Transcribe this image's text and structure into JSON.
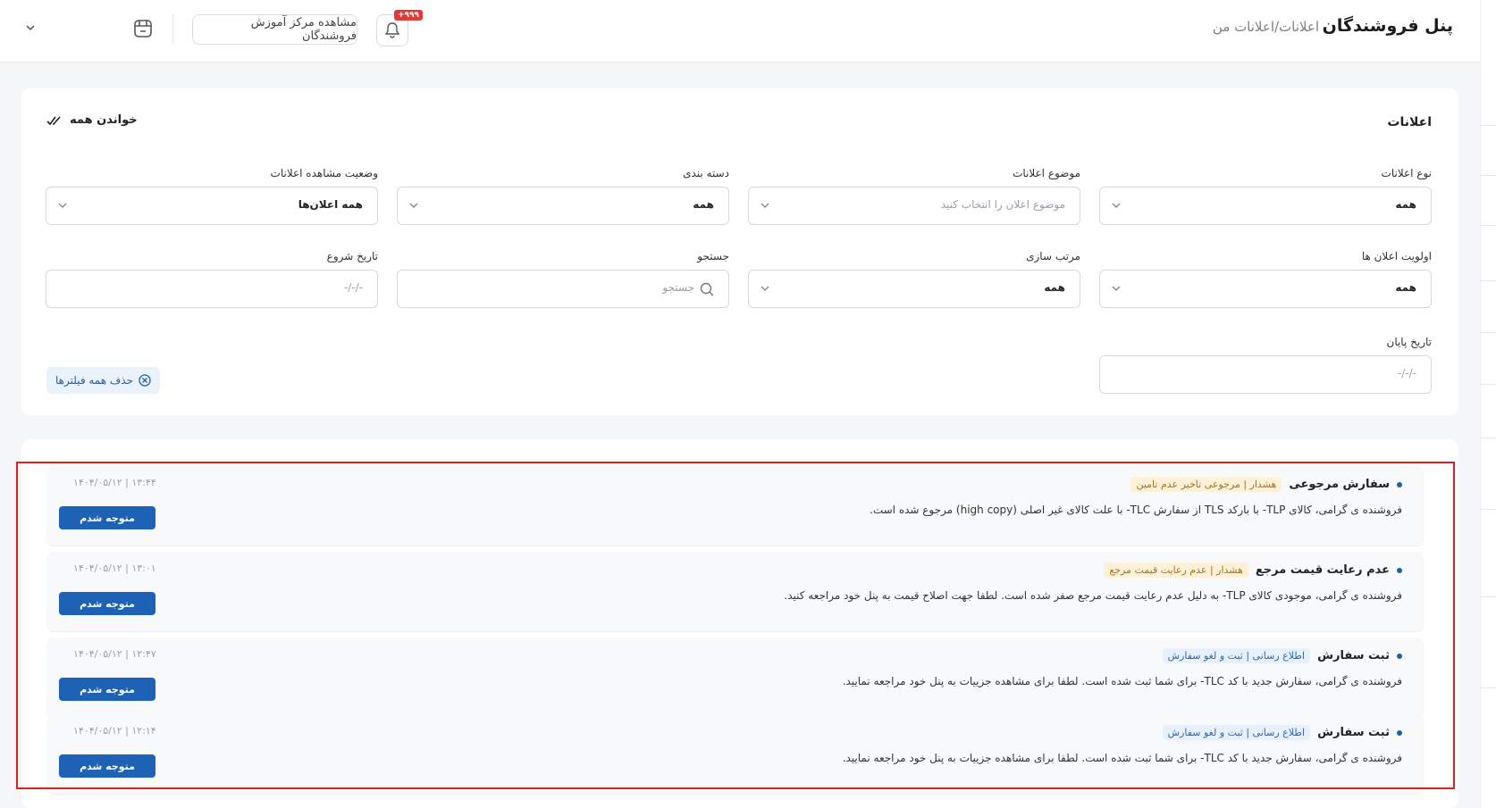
{
  "header": {
    "brand": "پنل فروشندگان",
    "breadcrumb": "اعلانات/اعلانات من",
    "notification_badge": "+۹۹۹",
    "education_button": "مشاهده مرکز آموزش فروشندگان",
    "icons": {
      "bell": "bell-icon",
      "store": "store-icon",
      "chevron": "chevron-down-icon"
    }
  },
  "filters": {
    "title": "اعلانات",
    "read_all": "خواندن همه",
    "notification_type": {
      "label": "نوع اعلانات",
      "value": "همه"
    },
    "notification_subject": {
      "label": "موضوع اعلانات",
      "placeholder": "موضوع اعلان را انتخاب کنید"
    },
    "category": {
      "label": "دسته بندی",
      "value": "همه"
    },
    "view_status": {
      "label": "وضعیت مشاهده اعلانات",
      "value": "همه اعلان‌ها"
    },
    "priority": {
      "label": "اولویت اعلان ها",
      "value": "همه"
    },
    "sort": {
      "label": "مرتب سازی",
      "value": "همه"
    },
    "search": {
      "label": "جستجو",
      "placeholder": "جستجو"
    },
    "start_date": {
      "label": "تاریخ شروع",
      "placeholder": "-/-/-"
    },
    "end_date": {
      "label": "تاریخ پایان",
      "placeholder": "-/-/-"
    },
    "clear_all": "حذف همه فیلترها"
  },
  "notifications": [
    {
      "title": "سفارش مرجوعی",
      "tag": "هشدار | مرجوعی تاخیر عدم تامین",
      "tag_kind": "warn",
      "body": "فروشنده ی گرامی، کالای TLP- با بارکد TLS از سفارش TLC- با علت کالای غیر اصلی (high copy) مرجوع شده است.",
      "date": "۱۴۰۴/۰۵/۱۲ | ۱۳:۴۴",
      "action": "متوجه شدم"
    },
    {
      "title": "عدم رعایت قیمت مرجع",
      "tag": "هشدار | عدم رعایت قیمت مرجع",
      "tag_kind": "warn",
      "body": "فروشنده ی گرامی، موجودی کالای TLP- به دلیل عدم رعایت قیمت مرجع صفر شده است. لطفا جهت اصلاح قیمت به پنل خود مراجعه کنید.",
      "date": "۱۴۰۴/۰۵/۱۲ | ۱۳:۰۱",
      "action": "متوجه شدم"
    },
    {
      "title": "ثبت سفارش",
      "tag": "اطلاع رسانی | ثبت و لغو سفارش",
      "tag_kind": "info",
      "body": "فروشنده ی گرامی، سفارش جدید با کد TLC- برای شما ثبت شده است. لطفا برای مشاهده جزییات به پنل خود مراجعه نمایید.",
      "date": "۱۴۰۴/۰۵/۱۲ | ۱۲:۴۷",
      "action": "متوجه شدم"
    },
    {
      "title": "ثبت سفارش",
      "tag": "اطلاع رسانی | ثبت و لغو سفارش",
      "tag_kind": "info",
      "body": "فروشنده ی گرامی، سفارش جدید با کد TLC- برای شما ثبت شده است. لطفا برای مشاهده جزییات به پنل خود مراجعه نمایید.",
      "date": "۱۴۰۴/۰۵/۱۲ | ۱۲:۱۴",
      "action": "متوجه شدم"
    }
  ]
}
